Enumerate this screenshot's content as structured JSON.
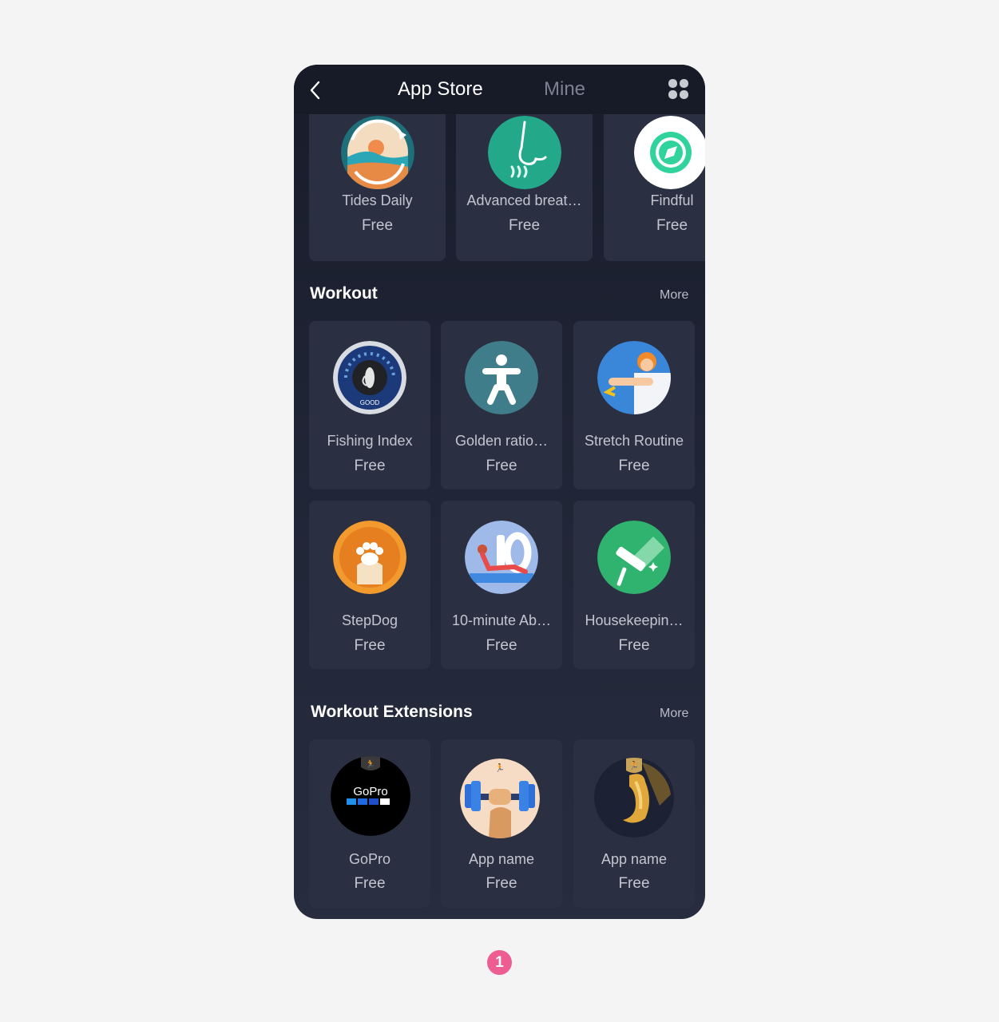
{
  "header": {
    "tab_app_store": "App Store",
    "tab_mine": "Mine"
  },
  "top_row": [
    {
      "name": "Tides Daily",
      "price": "Free",
      "icon": "tides-daily-icon"
    },
    {
      "name": "Advanced breat…",
      "price": "Free",
      "icon": "breathing-nose-icon"
    },
    {
      "name": "Findful",
      "price": "Free",
      "icon": "compass-icon"
    }
  ],
  "workout": {
    "title": "Workout",
    "more": "More",
    "apps": [
      {
        "name": "Fishing Index",
        "price": "Free",
        "icon": "fishing-gauge-icon",
        "gauge_label": "GOOD"
      },
      {
        "name": "Golden ratio…",
        "price": "Free",
        "icon": "body-figure-icon"
      },
      {
        "name": "Stretch Routine",
        "price": "Free",
        "icon": "stretching-person-icon"
      },
      {
        "name": "StepDog",
        "price": "Free",
        "icon": "paw-icon"
      },
      {
        "name": "10-minute Ab…",
        "price": "Free",
        "icon": "situp-10-icon"
      },
      {
        "name": "Housekeepin…",
        "price": "Free",
        "icon": "mop-icon"
      }
    ]
  },
  "extensions": {
    "title": "Workout Extensions",
    "more": "More",
    "apps": [
      {
        "name": "GoPro",
        "price": "Free",
        "icon": "gopro-logo-icon",
        "logo_text": "GoPro"
      },
      {
        "name": "App name",
        "price": "Free",
        "icon": "dumbbell-fist-icon"
      },
      {
        "name": "App name",
        "price": "Free",
        "icon": "muscle-arm-icon"
      }
    ]
  },
  "page_indicator": "1",
  "colors": {
    "background": "#f4f4f4",
    "panel": "#202536",
    "card": "#2a3042",
    "badge": "#ee5d92"
  }
}
